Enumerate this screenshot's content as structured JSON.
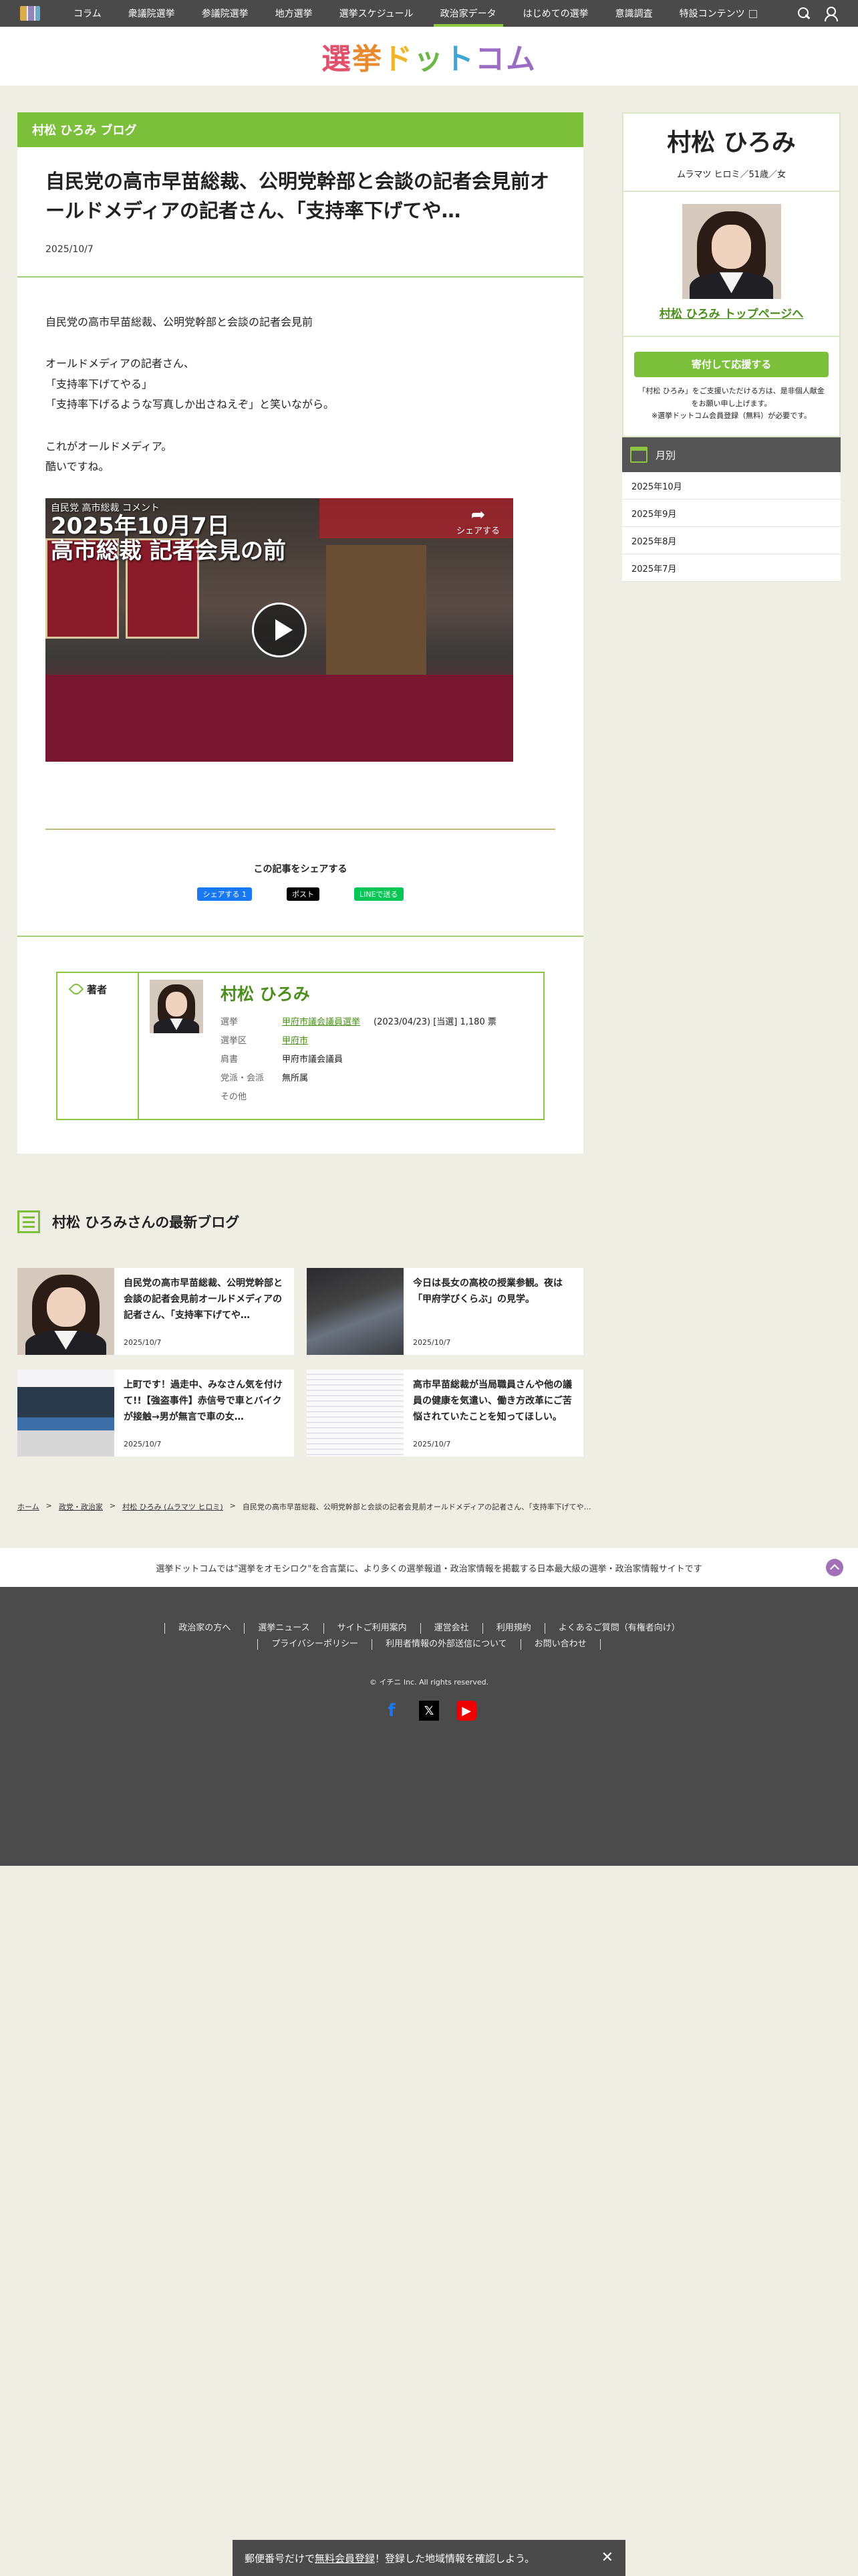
{
  "nav": {
    "items": [
      "コラム",
      "衆議院選挙",
      "参議院選挙",
      "地方選挙",
      "選挙スケジュール",
      "政治家データ",
      "はじめての選挙",
      "意識調査",
      "特設コンテンツ"
    ],
    "active_index": 5
  },
  "brand": {
    "logo_text": [
      "選",
      "挙",
      "ド",
      "ッ",
      "ト",
      "コム"
    ]
  },
  "article": {
    "blog_header": "村松 ひろみ ブログ",
    "title": "自民党の高市早苗総裁、公明党幹部と会談の記者会見前オールドメディアの記者さん、「支持率下げてや…",
    "date": "2025/10/7",
    "paragraphs": [
      "自民党の高市早苗総裁、公明党幹部と会談の記者会見前",
      "オールドメディアの記者さん、\n「支持率下げてやる」\n「支持率下げるような写真しか出さねえぞ」と笑いながら。",
      "これがオールドメディア。\n酷いですね。"
    ],
    "video": {
      "title_small": "自民党 高市総裁 コメント",
      "title_big_1": "2025年10月7日",
      "title_big_2": "高市総裁 記者会見の前",
      "share_label": "シェアする"
    }
  },
  "share": {
    "label": "この記事をシェアする",
    "facebook": "シェアする 1",
    "x": "ポスト",
    "line": "LINEで送る"
  },
  "author": {
    "label": "著者",
    "name": "村松 ひろみ",
    "rows": [
      {
        "key": "選挙",
        "value": "甲府市議会議員選挙",
        "note": "(2023/04/23) [当選] 1,180 票",
        "link": true
      },
      {
        "key": "選挙区",
        "value": "甲府市",
        "note": "",
        "link": true
      },
      {
        "key": "肩書",
        "value": "甲府市議会議員",
        "note": "",
        "link": false
      },
      {
        "key": "党派・会派",
        "value": "無所属",
        "note": "",
        "link": false
      },
      {
        "key": "その他",
        "value": "",
        "note": "",
        "link": false
      }
    ]
  },
  "latest": {
    "heading": "村松 ひろみさんの最新ブログ",
    "cards": [
      {
        "title": "自民党の高市早苗総裁、公明党幹部と会談の記者会見前オールドメディアの記者さん、「支持率下げてや…",
        "date": "2025/10/7"
      },
      {
        "title": "今日は長女の高校の授業参観。夜は「甲府学びくらぶ」の見学。",
        "date": "2025/10/7"
      },
      {
        "title": "上町です！過走中、みなさん気を付けて!!【強盗事件】赤信号で車とバイクが接触→男が無言で車の女…",
        "date": "2025/10/7"
      },
      {
        "title": "高市早苗総裁が当局職員さんや他の議員の健康を気遣い、働き方改革にご苦悩されていたことを知ってほしい。",
        "date": "2025/10/7"
      }
    ]
  },
  "breadcrumb": [
    "ホーム",
    "政党・政治家",
    "村松 ひろみ (ムラマツ ヒロミ)",
    "自民党の高市早苗総裁、公明党幹部と会談の記者会見前オールドメディアの記者さん、「支持率下げてや…"
  ],
  "tagline": "選挙ドットコムでは\"選挙をオモシロク\"を合言葉に、より多くの選挙報道・政治家情報を掲載する日本最大級の選挙・政治家情報サイトです",
  "footer": {
    "links": [
      "政治家の方へ",
      "選挙ニュース",
      "サイトご利用案内",
      "運営会社",
      "利用規約",
      "よくあるご質問（有権者向け）",
      "プライバシーポリシー",
      "利用者情報の外部送信について",
      "お問い合わせ"
    ],
    "copyright": "© イチニ Inc. All rights reserved."
  },
  "sidebar": {
    "name": "村松 ひろみ",
    "meta": "ムラマツ ヒロミ／51歳／女",
    "top_link": "村松 ひろみ トップページへ",
    "donate": "寄付して応援する",
    "donate_note": "「村松 ひろみ」をご支援いただける方は、是非個人献金をお願い申し上げます。\n※選挙ドットコム会員登録（無料）が必要です。",
    "monthly_heading": "月別",
    "months": [
      "2025年10月",
      "2025年9月",
      "2025年8月",
      "2025年7月"
    ]
  },
  "notice": {
    "before": "郵便番号だけで",
    "link": "無料会員登録",
    "after": "！登録した地域情報を確認しよう。"
  },
  "colors": {
    "accent_green": "#7bbf3b",
    "nav_bg": "#4a4a4a",
    "page_bg": "#efeee4"
  }
}
